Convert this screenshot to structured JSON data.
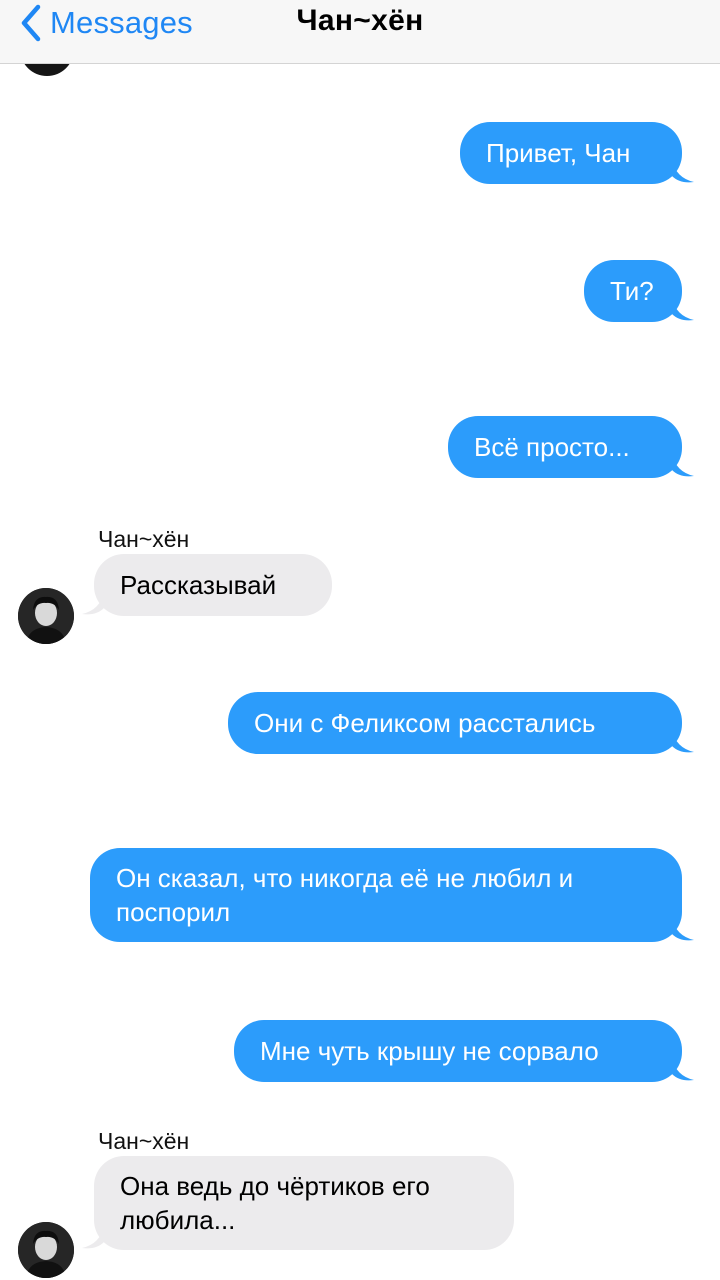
{
  "nav": {
    "back_label": "Messages",
    "title": "Чан~хён"
  },
  "messages": [
    {
      "side": "out",
      "text": "Привет, Чан"
    },
    {
      "side": "out",
      "text": "Ти?"
    },
    {
      "side": "out",
      "text": "Всё просто..."
    },
    {
      "side": "in",
      "sender": "Чан~хён",
      "text": "Рассказывай"
    },
    {
      "side": "out",
      "text": "Они с Феликсом расстались"
    },
    {
      "side": "out",
      "text": "Он сказал, что никогда её не любил и поспорил"
    },
    {
      "side": "out",
      "text": "Мне чуть крышу не сорвало"
    },
    {
      "side": "in",
      "sender": "Чан~хён",
      "text": "Она ведь до чёртиков его любила..."
    }
  ],
  "colors": {
    "outgoing_bubble": "#2c9cfb",
    "incoming_bubble": "#ecebed",
    "accent": "#1f87f4"
  }
}
